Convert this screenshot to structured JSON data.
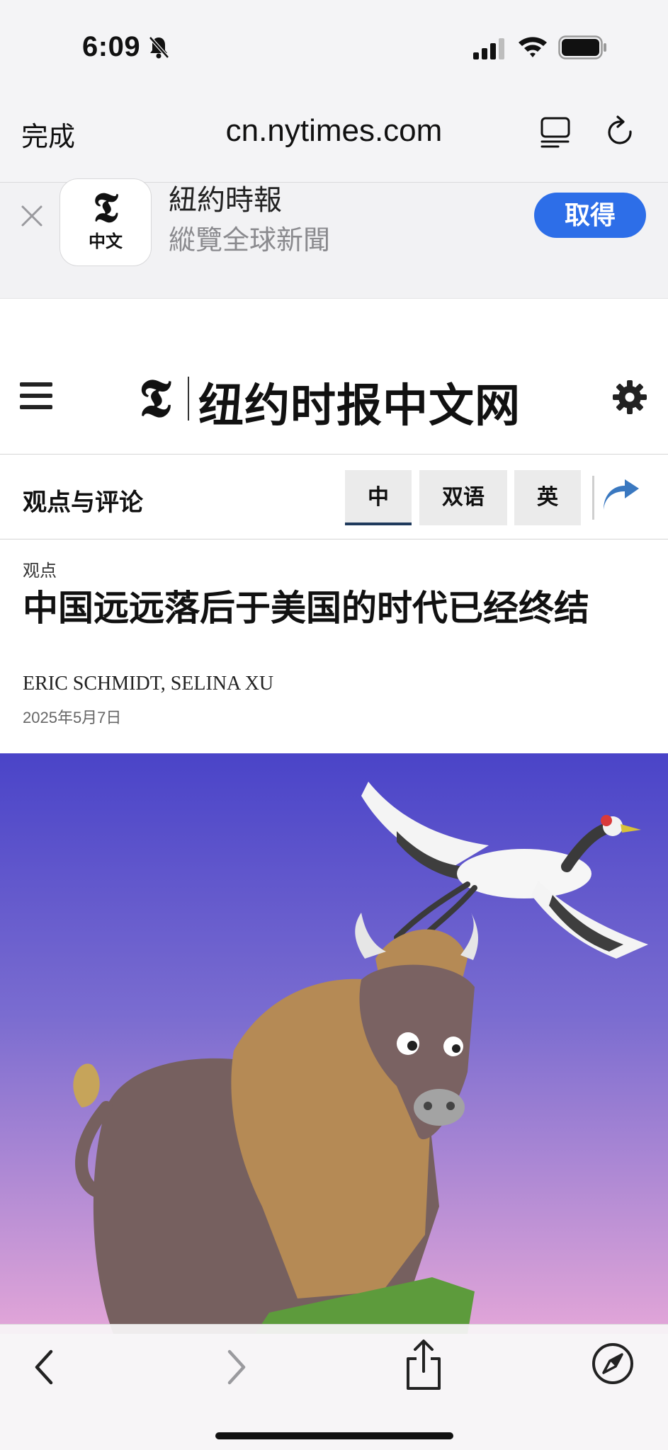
{
  "status": {
    "time": "6:09"
  },
  "browser": {
    "done_label": "完成",
    "url": "cn.nytimes.com"
  },
  "app_banner": {
    "icon_letter": "𝕿",
    "icon_caption": "中文",
    "name": "紐約時報",
    "subtitle": "縱覽全球新聞",
    "get_label": "取得"
  },
  "site": {
    "logo_letter": "𝕿",
    "title": "纽约时报中文网"
  },
  "section": {
    "label": "观点与评论",
    "tabs": [
      {
        "label": "中",
        "active": true
      },
      {
        "label": "双语",
        "active": false
      },
      {
        "label": "英",
        "active": false
      }
    ]
  },
  "article": {
    "kicker": "观点",
    "headline": "中国远远落后于美国的时代已经终结",
    "byline": "ERIC SCHMIDT, SELINA XU",
    "date": "2025年5月7日"
  },
  "colors": {
    "accent_blue": "#2d6ee8",
    "share_arrow": "#3a78c0",
    "tab_underline": "#1f3a5c",
    "hero_top": "#4a44c8",
    "hero_bottom": "#e3a6d8"
  },
  "icons": {
    "status": [
      "bell-off-icon",
      "signal-icon",
      "wifi-icon",
      "battery-icon"
    ],
    "top_bar": [
      "reader-icon",
      "reload-icon"
    ],
    "bottom_bar": [
      "back-icon",
      "forward-icon",
      "share-icon",
      "compass-icon"
    ]
  }
}
